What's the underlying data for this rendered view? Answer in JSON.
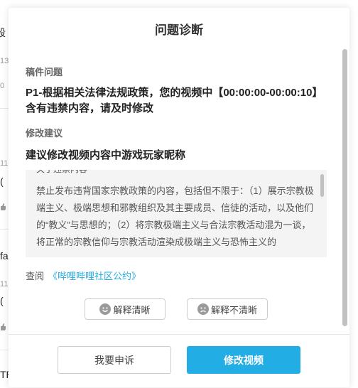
{
  "background": {
    "fragments": [
      "段",
      "13",
      "0",
      "11",
      "(",
      "fa",
      "11",
      "(",
      "TR"
    ]
  },
  "modal": {
    "title": "问题诊断",
    "problem_label": "稿件问题",
    "problem_text": "P1-根据相关法律法规政策，您的视频中【00:00:00-00:00:10】含有违禁内容，请及时修改",
    "suggest_label": "修改建议",
    "suggest_text": "建议修改视频内容中游戏玩家昵称",
    "rule_heading": "关于违禁内容",
    "rule_body": "禁止发布违背国家宗教政策的内容，包括但不限于：（1）展示宗教极端主义、极端思想和邪教组织及其主要成员、信徒的活动，以及他们的“教义”与思想的；（2）将宗教极端主义与合法宗教活动混为一谈，将正常的宗教信仰与宗教活动渲染成极端主义与恐怖主义的",
    "link_prefix": "查阅",
    "link_text": "《哔哩哔哩社区公约》",
    "feedback_clear": "解释清晰",
    "feedback_unclear": "解释不清晰",
    "appeal_button": "我要申诉",
    "edit_button": "修改视频"
  },
  "colors": {
    "accent": "#23ade5",
    "link": "#23ade5"
  }
}
